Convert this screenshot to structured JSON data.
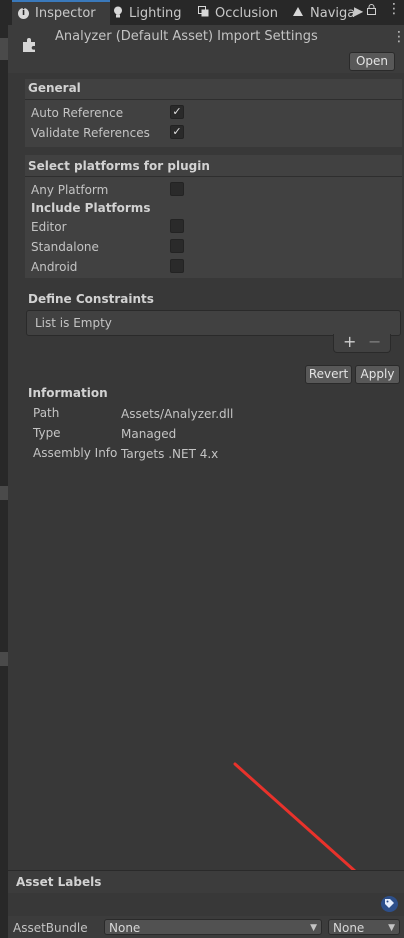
{
  "tabs": [
    {
      "label": "Inspector",
      "icon": "info-icon"
    },
    {
      "label": "Lighting",
      "icon": "lightbulb-icon"
    },
    {
      "label": "Occlusion",
      "icon": "occlusion-icon"
    },
    {
      "label": "Naviga",
      "icon": "navigation-icon"
    }
  ],
  "header": {
    "title": "Analyzer (Default Asset) Import Settings",
    "icon": "puzzle-piece-icon",
    "open_label": "Open"
  },
  "general": {
    "title": "General",
    "auto_reference": {
      "label": "Auto Reference",
      "checked": true
    },
    "validate_references": {
      "label": "Validate References",
      "checked": true
    }
  },
  "platforms": {
    "title": "Select platforms for plugin",
    "any_platform": {
      "label": "Any Platform",
      "checked": false
    },
    "include_title": "Include Platforms",
    "editor": {
      "label": "Editor",
      "checked": false
    },
    "standalone": {
      "label": "Standalone",
      "checked": false
    },
    "android": {
      "label": "Android",
      "checked": false
    }
  },
  "constraints": {
    "title": "Define Constraints",
    "empty_text": "List is Empty",
    "add_symbol": "+",
    "remove_symbol": "−"
  },
  "actions": {
    "revert_label": "Revert",
    "apply_label": "Apply"
  },
  "information": {
    "title": "Information",
    "rows": [
      {
        "key": "Path",
        "value": "Assets/Analyzer.dll"
      },
      {
        "key": "Type",
        "value": "Managed"
      },
      {
        "key": "Assembly Info",
        "value": "Targets .NET 4.x"
      }
    ]
  },
  "footer": {
    "asset_labels_title": "Asset Labels",
    "asset_bundle_label": "AssetBundle",
    "bundle_value": "None",
    "variant_value": "None"
  },
  "colors": {
    "accent": "#3a79bb",
    "tag_icon_bg": "#2d4f8a",
    "annotation_arrow": "#e8322b"
  }
}
